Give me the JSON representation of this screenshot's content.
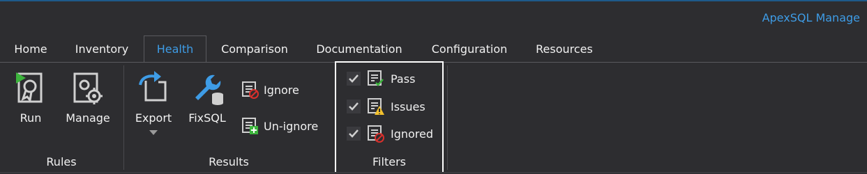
{
  "app": {
    "title": "ApexSQL Manage"
  },
  "tabs": [
    {
      "label": "Home"
    },
    {
      "label": "Inventory"
    },
    {
      "label": "Health",
      "active": true
    },
    {
      "label": "Comparison"
    },
    {
      "label": "Documentation"
    },
    {
      "label": "Configuration"
    },
    {
      "label": "Resources"
    }
  ],
  "ribbon": {
    "rules": {
      "label": "Rules",
      "run": "Run",
      "manage": "Manage"
    },
    "results": {
      "label": "Results",
      "export": "Export",
      "fixsql": "FixSQL",
      "ignore": "Ignore",
      "unignore": "Un-ignore"
    },
    "filters": {
      "label": "Filters",
      "items": [
        {
          "label": "Pass",
          "checked": true
        },
        {
          "label": "Issues",
          "checked": true
        },
        {
          "label": "Ignored",
          "checked": true
        }
      ]
    }
  },
  "colors": {
    "accent": "#3e9ce6",
    "background": "#2d2d30",
    "run_green": "#3cb43c",
    "warning": "#f2c12e",
    "error": "#d9302c"
  }
}
